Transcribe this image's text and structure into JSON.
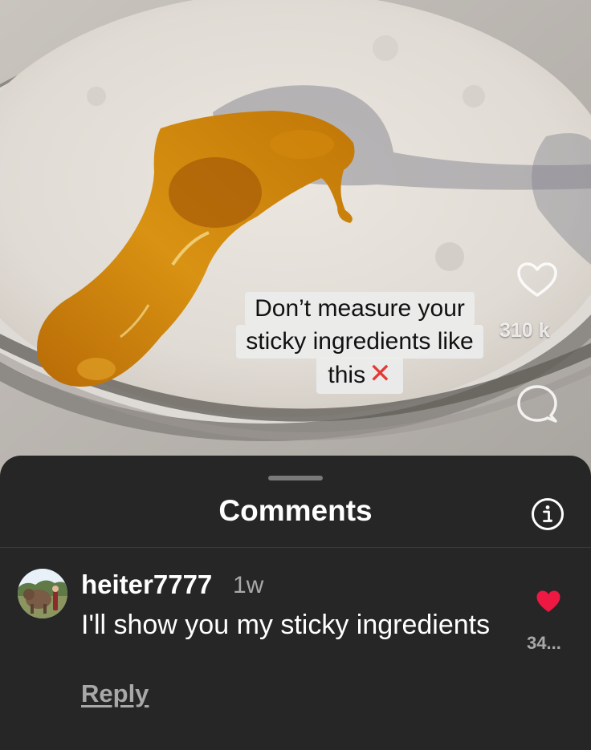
{
  "video": {
    "caption_lines": [
      "Don’t measure your",
      "sticky ingredients like",
      "this"
    ],
    "caption_mark": "✕",
    "like_count": "310 k",
    "icons": [
      "heart-outline-icon",
      "comment-bubble-icon"
    ]
  },
  "comments_sheet": {
    "title": "Comments",
    "info_icon": "info-icon",
    "comments": [
      {
        "username": "heiter7777",
        "time": "1w",
        "text": "I'll show you my sticky ingredients",
        "reply_label": "Reply",
        "likes": "34...",
        "liked": true,
        "heart_color": "#ed1942"
      }
    ]
  },
  "colors": {
    "sheet_background": "#262626",
    "caption_x": "#e53935"
  }
}
